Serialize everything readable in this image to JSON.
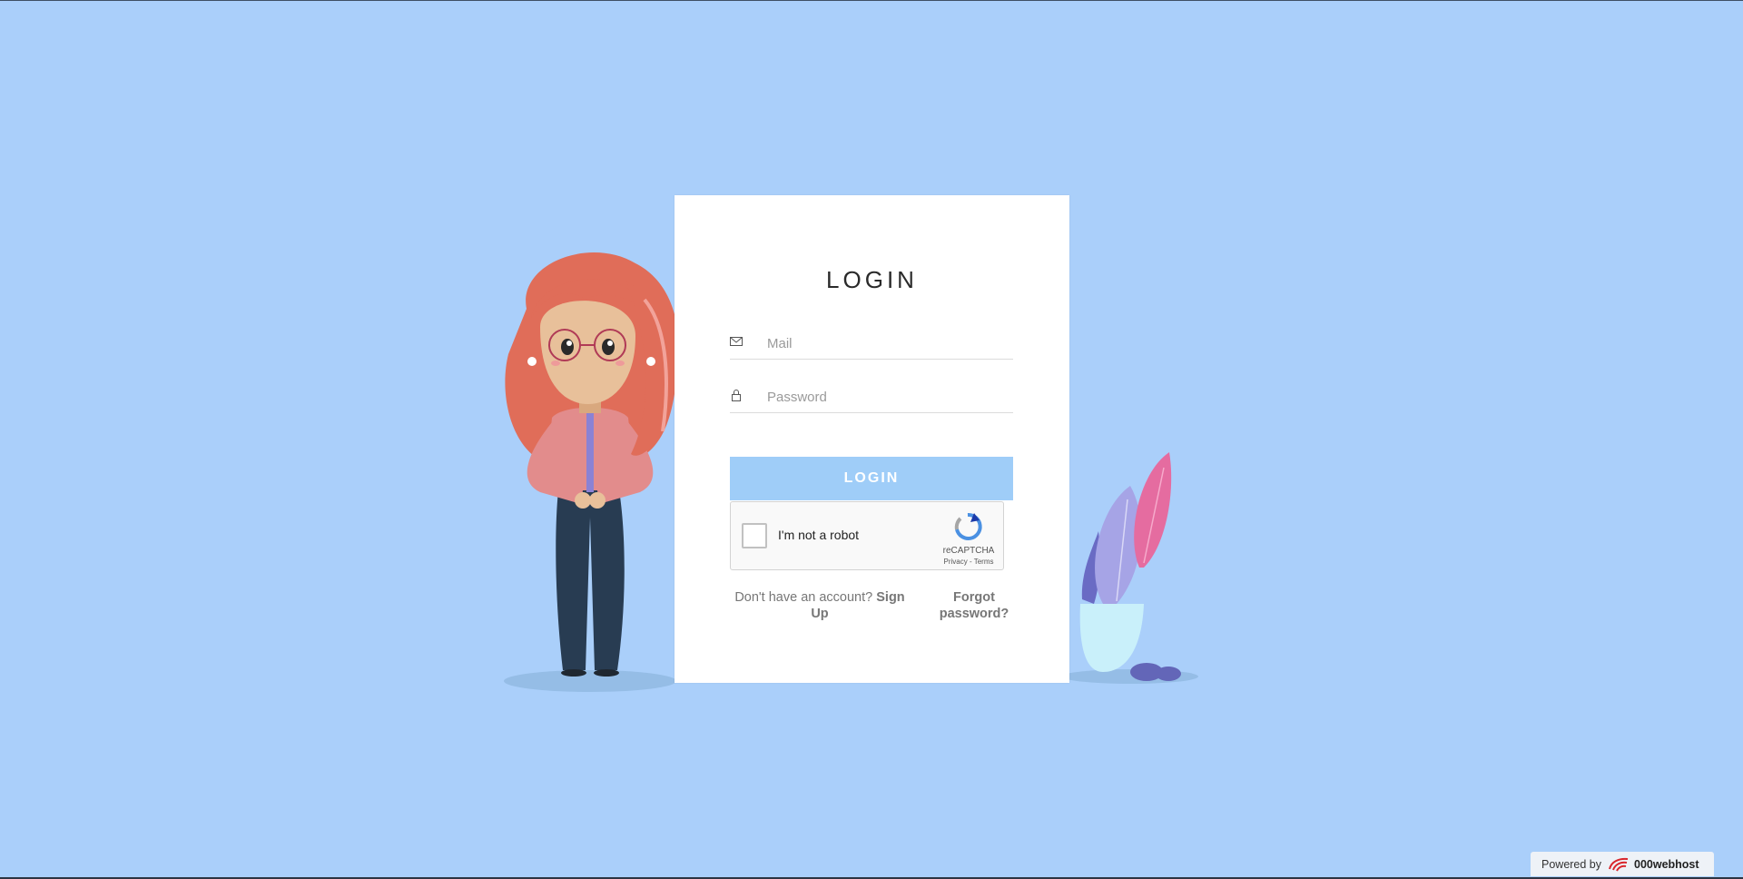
{
  "login": {
    "title": "LOGIN",
    "mail_placeholder": "Mail",
    "password_placeholder": "Password",
    "login_button": "LOGIN",
    "no_account_text": "Don't have an account?",
    "signup_link": "Sign Up",
    "forgot_link": "Forgot password?"
  },
  "captcha": {
    "label": "I'm not a robot",
    "brand": "reCAPTCHA",
    "links": "Privacy - Terms"
  },
  "footer": {
    "powered_label": "Powered by",
    "host_name": "000webhost"
  },
  "colors": {
    "background": "#aacffa",
    "button": "#9fcdf8",
    "card": "#ffffff"
  },
  "icons": {
    "mail": "envelope-icon",
    "password": "lock-icon",
    "captcha": "recaptcha-logo-icon",
    "host": "000webhost-logo-icon"
  }
}
